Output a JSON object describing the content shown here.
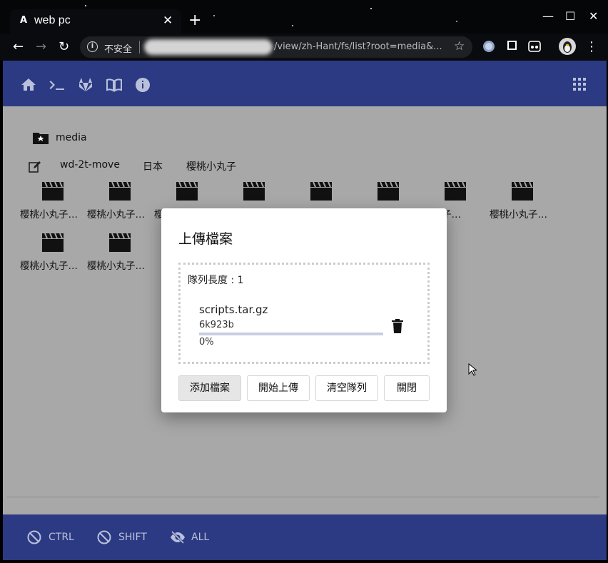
{
  "browser": {
    "tab_title": "web pc",
    "tab_favicon": "A",
    "security_label": "不安全",
    "url_visible": "/view/zh-Hant/fs/list?root=media&..."
  },
  "toolbar_icons": [
    "home-icon",
    "terminal-icon",
    "gitlab-icon",
    "book-icon",
    "info-icon",
    "apps-grid-icon"
  ],
  "fs": {
    "root_label": "media",
    "path": [
      "wd-2t-move",
      "日本",
      "樱桃小丸子"
    ],
    "files": [
      {
        "name": "樱桃小丸子…"
      },
      {
        "name": "樱桃小丸子…"
      },
      {
        "name": "樱"
      },
      {
        "name": ""
      },
      {
        "name": ""
      },
      {
        "name": ""
      },
      {
        "name": "小丸子…"
      },
      {
        "name": "樱桃小丸子…"
      },
      {
        "name": "樱桃小丸子…"
      },
      {
        "name": "樱桃小丸子…"
      }
    ]
  },
  "dialog": {
    "title": "上傳檔案",
    "queue_length": "隊列長度 : 1",
    "queue": [
      {
        "name": "scripts.tar.gz",
        "size": "6k923b",
        "progress_label": "0%",
        "progress": 0
      }
    ],
    "buttons": {
      "add": "添加檔案",
      "start": "開始上傳",
      "clear": "清空隊列",
      "close": "關閉"
    }
  },
  "keys": {
    "ctrl": "CTRL",
    "shift": "SHIFT",
    "all": "ALL"
  },
  "colors": {
    "appbar": "#2b3a82",
    "icon": "#b9c0da",
    "progress": "#3f51b5"
  }
}
